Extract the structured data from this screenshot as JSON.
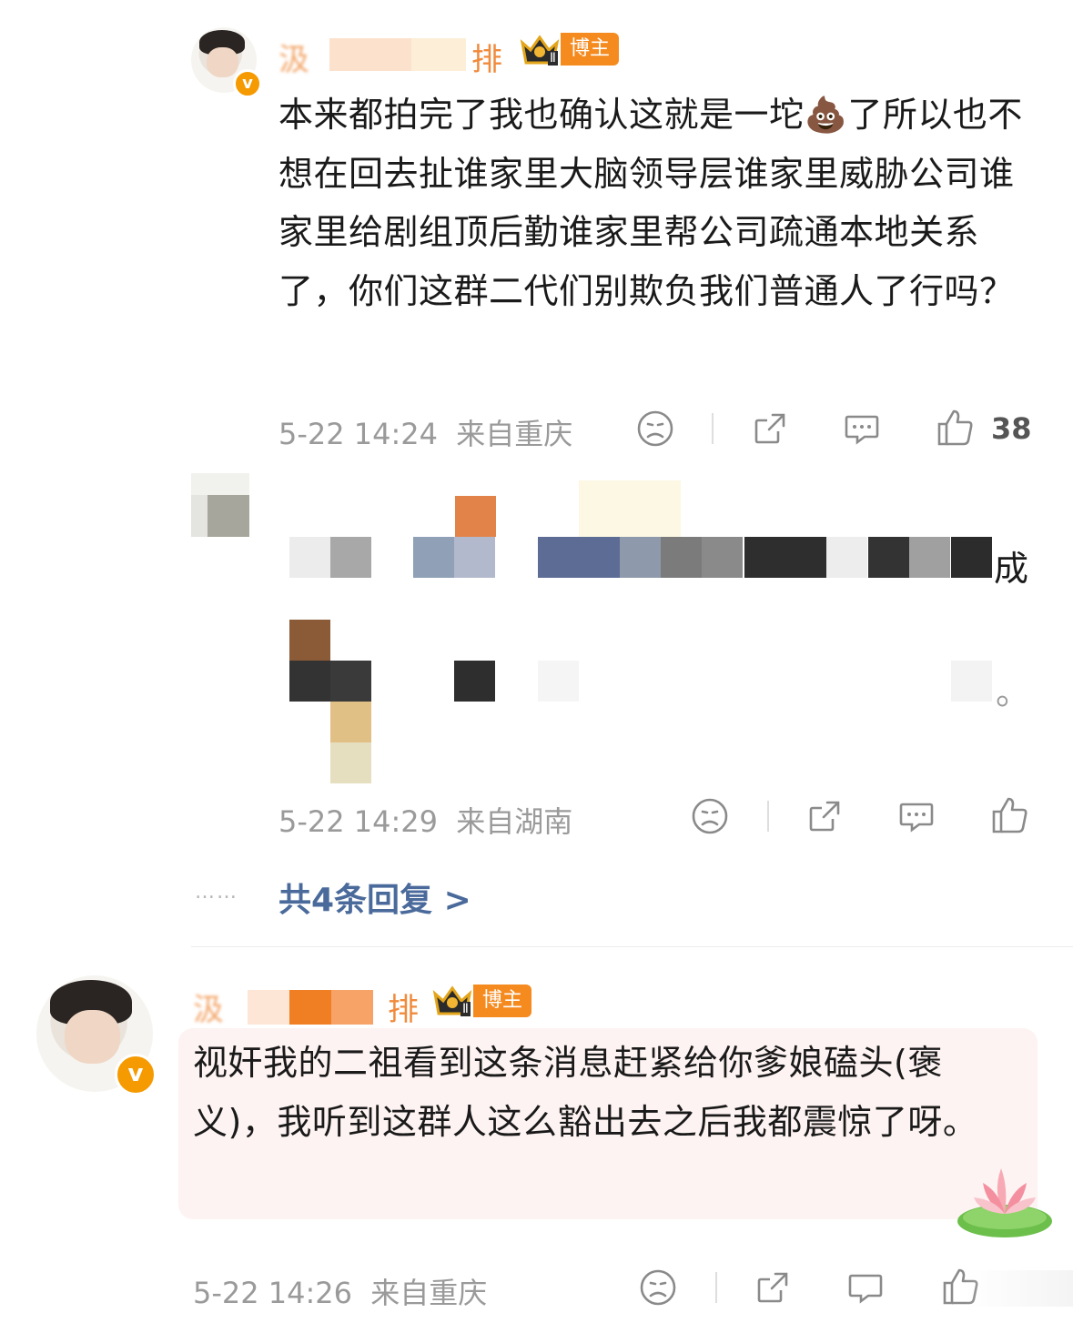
{
  "colors": {
    "accent_orange": "#f58a1f",
    "link_blue": "#4a6a9b",
    "meta_gray": "#9a9a9a",
    "text_dark": "#1a1a1a"
  },
  "comment1": {
    "name_visible_start": "汲",
    "name_visible_end": "排",
    "badge": "博主",
    "badge_rank": "Ⅱ",
    "text": "本来都拍完了我也确认这就是一坨💩了所以也不想在回去扯谁家里大脑领导层谁家里威胁公司谁家里给剧组顶后勤谁家里帮公司疏通本地关系了，你们这群二代们别欺负我们普通人了行吗？",
    "date": "5-22 14:24",
    "location": "来自重庆",
    "like_count": "38",
    "icons": [
      "sad-face-icon",
      "share-icon",
      "comment-icon",
      "thumbs-up-icon"
    ]
  },
  "reply": {
    "text_visible_fragment": "成",
    "text_end_fragment": "。",
    "date": "5-22 14:29",
    "location": "来自湖南",
    "icons": [
      "sad-face-icon",
      "share-icon",
      "comment-icon",
      "thumbs-up-icon"
    ]
  },
  "replies_summary": {
    "dots": "……",
    "label": "共4条回复 >"
  },
  "comment2": {
    "name_visible_start": "汲",
    "name_visible_end": "排",
    "badge": "博主",
    "badge_rank": "Ⅱ",
    "text": "视奸我的二祖看到这条消息赶紧给你爹娘磕头(褒义)，我听到这群人这么豁出去之后我都震惊了呀。",
    "date": "5-22 14:26",
    "location": "来自重庆",
    "icons": [
      "sad-face-icon",
      "share-icon",
      "comment-icon",
      "thumbs-up-icon"
    ]
  },
  "verified_mark": "v"
}
